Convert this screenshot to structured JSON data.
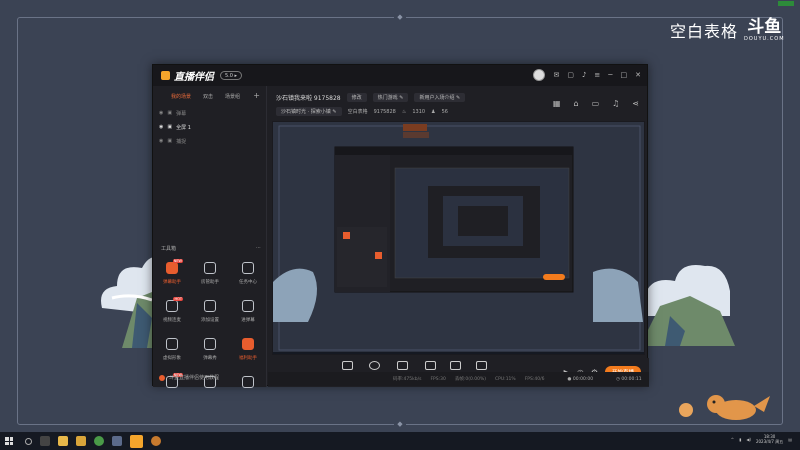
{
  "brand": {
    "text": "空白表格",
    "logo_main": "斗鱼",
    "logo_sub": "DOUYU.COM"
  },
  "app": {
    "logo_text": "直播伴侣",
    "version": "5.0",
    "sidebar": {
      "tabs": [
        "我的场景",
        "双击",
        "场景组"
      ],
      "scenes": [
        {
          "label": "弹幕",
          "visible": false
        },
        {
          "label": "全屏 1",
          "visible": true
        },
        {
          "label": "捕捉",
          "visible": false
        }
      ],
      "tools_label": "工具箱",
      "tools": [
        {
          "label": "弹幕助手",
          "icon": "danmu-icon",
          "hot": true,
          "badge": "NEW"
        },
        {
          "label": "房管助手",
          "icon": "user-icon",
          "hot": false
        },
        {
          "label": "任务中心",
          "icon": "task-icon",
          "hot": false
        },
        {
          "label": "视频连麦",
          "icon": "video-link-icon",
          "hot": false,
          "badge": "HOT"
        },
        {
          "label": "添加设置",
          "icon": "download-icon",
          "hot": false
        },
        {
          "label": "进弹幕",
          "icon": "image-icon",
          "hot": false
        },
        {
          "label": "虚拟形象",
          "icon": "handshake-icon",
          "hot": false
        },
        {
          "label": "弹幕秀",
          "icon": "tv-icon",
          "hot": false
        },
        {
          "label": "福利助手",
          "icon": "gift-icon",
          "hot": true
        },
        {
          "label": "",
          "icon": "fire-icon",
          "hot": false,
          "badge": "NEW"
        },
        {
          "label": "",
          "icon": "brush-icon",
          "hot": false
        },
        {
          "label": "",
          "icon": "car-icon",
          "hot": false
        }
      ],
      "footer": "斗鱼直播伴侣使用教程"
    },
    "room": {
      "title": "沙石镇我来啦 9175828",
      "edit_label": "修改",
      "tag1": "热门游戏",
      "tag2": "新用户入场介绍",
      "sub": "沙石镇时光 · 探索小镇",
      "category": "空白表格",
      "room_id": "9175828",
      "heat": "1310",
      "fans": "56"
    },
    "bottom_tools": [
      {
        "label": "直播屏幕",
        "icon": "screen-icon"
      },
      {
        "label": "摄像头",
        "icon": "camera-icon"
      },
      {
        "label": "手机投屏",
        "icon": "phone-cast-icon"
      },
      {
        "label": "多媒体",
        "icon": "media-icon"
      },
      {
        "label": "麦克风",
        "icon": "mic-icon"
      },
      {
        "label": "扬声器",
        "icon": "speaker-icon"
      }
    ],
    "go_live": "开始直播",
    "status": {
      "bitrate": "码率:475kb/s",
      "fps": "FPS:30",
      "drop": "丢帧:0(0.00%)",
      "cpu": "CPU:11%",
      "fps2": "FPS:40/6",
      "rec_time": "00:00:00",
      "live_time": "00:00:11"
    }
  },
  "taskbar": {
    "time": "18:30",
    "date": "2023/4/7 周五"
  }
}
